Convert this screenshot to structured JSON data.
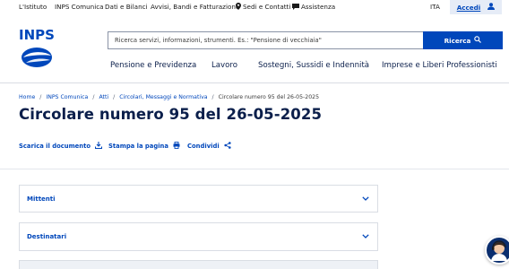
{
  "topbar": {
    "links": [
      "L'Istituto",
      "INPS Comunica",
      "Dati e Bilanci",
      "Avvisi, Bandi e Fatturazione",
      "Sedi e Contatti",
      "Assistenza"
    ],
    "lang": "ITA",
    "login": "Accedi"
  },
  "header": {
    "logo_text": "INPS",
    "search_placeholder": "Ricerca servizi, informazioni, strumenti. Es.: \"Pensione di vecchiaia\"",
    "search_button": "Ricerca",
    "nav": [
      "Pensione e Previdenza",
      "Lavoro",
      "Sostegni, Sussidi e Indennità",
      "Imprese e Liberi Professionisti"
    ]
  },
  "breadcrumb": [
    "Home",
    "INPS Comunica",
    "Atti",
    "Circolari, Messaggi e Normativa",
    "Circolare numero 95 del 26-05-2025"
  ],
  "page": {
    "title": "Circolare numero 95 del 26-05-2025",
    "actions": [
      "Scarica il documento",
      "Stampa la pagina",
      "Condividi"
    ],
    "accordions": [
      "Mittenti",
      "Destinatari"
    ]
  },
  "colors": {
    "brand": "#0047bb",
    "title": "#0b1f4b"
  }
}
